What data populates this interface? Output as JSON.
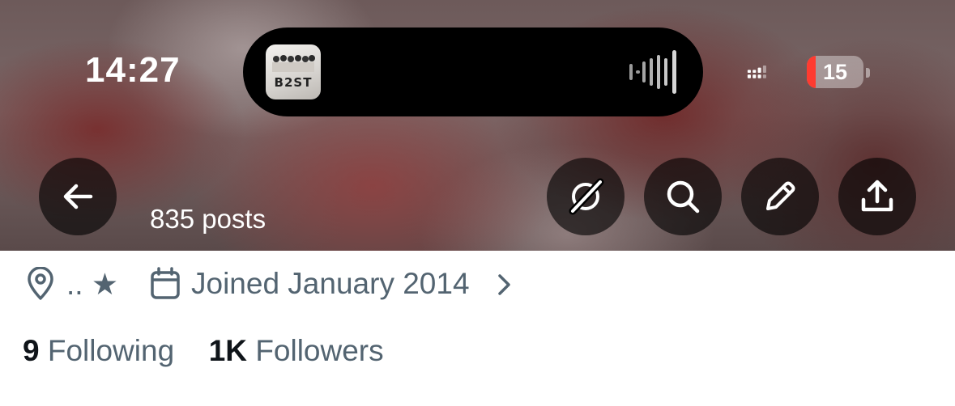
{
  "status_bar": {
    "time": "14:27",
    "battery_level": "15",
    "battery_color": "#ff3b30",
    "album_art_text": "B2ST"
  },
  "header": {
    "posts_count": "835 posts",
    "icons": [
      "back-arrow-icon",
      "grok-icon",
      "search-icon",
      "pencil-icon",
      "share-icon"
    ]
  },
  "profile": {
    "location": ".. ★",
    "joined": "Joined January 2014",
    "following_count": "9",
    "following_label": "Following",
    "followers_count": "1K",
    "followers_label": "Followers"
  },
  "colors": {
    "secondary_text": "#536471",
    "primary_text": "#0f1419",
    "button_bg": "rgba(0,0,0,0.62)"
  }
}
